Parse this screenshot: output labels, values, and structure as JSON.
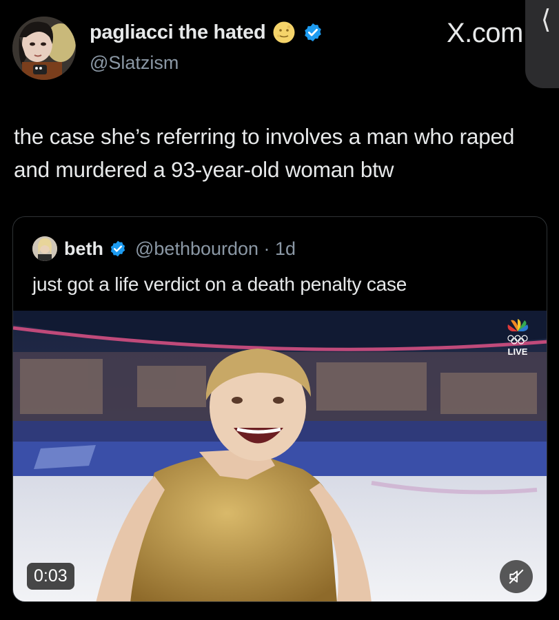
{
  "author": {
    "display_name": "pagliacci the hated",
    "handle": "@Slatzism",
    "emoji": "moon-face-emoji",
    "verified_icon": "verified-badge-icon"
  },
  "site_label": "X.com",
  "side_tab_icon": "chevron-left-icon",
  "tweet": {
    "text": "the case she’s referring to involves a man who raped and murdered a 93-year-old woman btw"
  },
  "quoted": {
    "display_name": "beth",
    "handle": "@bethbourdon",
    "age": " · 1d",
    "text": "just got a life verdict on a death penalty case",
    "video": {
      "timestamp": "0:03",
      "live_label": "LIVE",
      "mute_icon": "speaker-muted-icon"
    }
  },
  "colors": {
    "background": "#000000",
    "text_primary": "#e7e9ea",
    "text_secondary": "#8b98a5",
    "verified_blue": "#1d9bf0",
    "border": "#2f3336"
  }
}
